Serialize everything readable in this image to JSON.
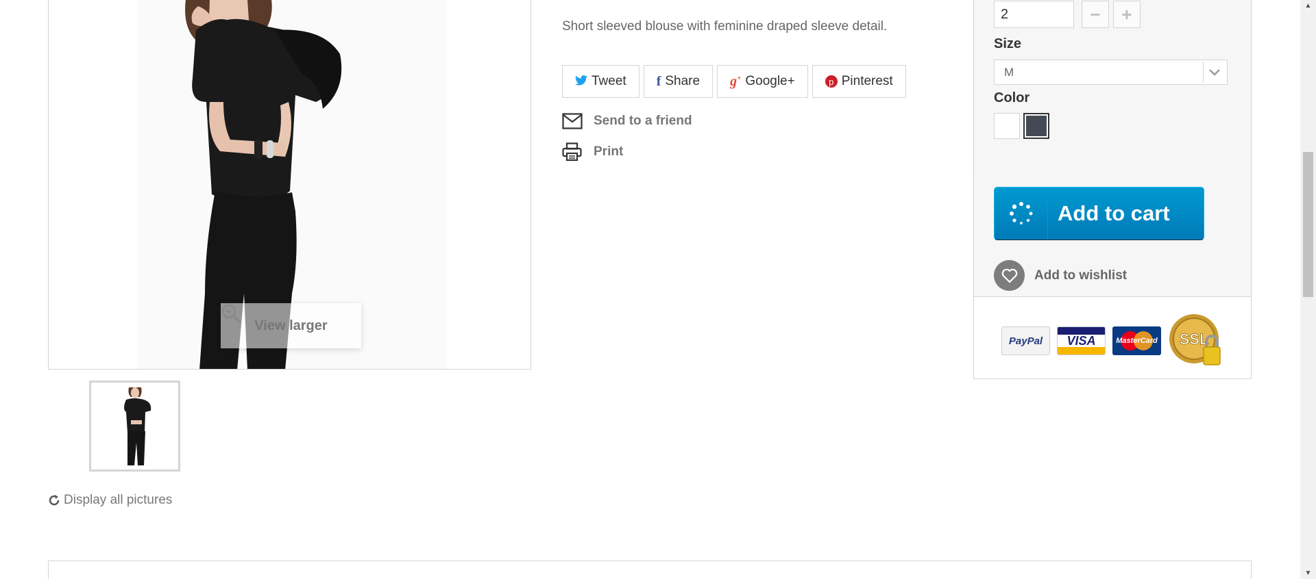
{
  "product": {
    "description": "Short sleeved blouse with feminine draped sleeve detail.",
    "view_larger": "View larger",
    "display_all": "Display all pictures"
  },
  "social": {
    "tweet": "Tweet",
    "share": "Share",
    "google": "Google+",
    "pinterest": "Pinterest"
  },
  "links": {
    "send_friend": "Send to a friend",
    "print": "Print"
  },
  "buy": {
    "quantity": "2",
    "size_label": "Size",
    "size_value": "M",
    "color_label": "Color",
    "colors": [
      "#ffffff",
      "#434a54"
    ],
    "add_to_cart": "Add to cart",
    "add_to_wishlist": "Add to wishlist"
  },
  "payments": {
    "paypal": "PayPal",
    "visa": "VISA",
    "mastercard": "MasterCard",
    "ssl": "SSL"
  },
  "colors": {
    "accent_blue": "#0084c2",
    "border": "#d6d4d4"
  }
}
